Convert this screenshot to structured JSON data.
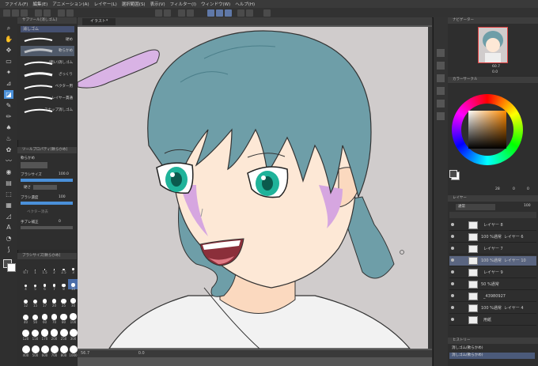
{
  "menu": [
    "ファイル(F)",
    "編集(E)",
    "アニメーション(A)",
    "レイヤー(L)",
    "選択範囲(S)",
    "表示(V)",
    "フィルター(I)",
    "ウィンドウ(W)",
    "ヘルプ(H)"
  ],
  "subtool": {
    "header": "サブツール[消しゴム]",
    "group_tab": "消しゴム",
    "items": [
      "硬め",
      "軟らかめ",
      "(粗い)消しゴム",
      "ざっくり",
      "ベクター用",
      "レイヤー貫通",
      "スナップ消しゴム"
    ],
    "selected_index": 1
  },
  "toolprop": {
    "header": "ツールプロパティ[軟らかめ]",
    "group": "軟らかめ",
    "rows": [
      {
        "label": "ブラシサイズ",
        "value": "100.0"
      },
      {
        "label": "硬さ",
        "value": ""
      },
      {
        "label": "ブラシ濃度",
        "value": "100"
      },
      {
        "label": "ベクター消去",
        "value": ""
      },
      {
        "label": "手ブレ補正",
        "value": "0"
      }
    ]
  },
  "brushsize": {
    "header": "ブラシサイズ[軟らかめ]",
    "values": [
      "0.7",
      "1",
      "1.5",
      "2",
      "2.5",
      "3",
      "4",
      "5",
      "6",
      "7",
      "8",
      "10",
      "12",
      "15",
      "17",
      "20",
      "25",
      "30",
      "40",
      "50",
      "60",
      "70",
      "80",
      "100",
      "120",
      "150",
      "170",
      "200",
      "250",
      "300",
      "400",
      "500",
      "600",
      "700",
      "800",
      "1000"
    ],
    "selected": "10"
  },
  "canvas": {
    "tab": "イラスト*"
  },
  "status": {
    "zoom": "56.7",
    "angle": "0.0"
  },
  "navigator": {
    "header": "ナビゲーター",
    "zoom": "60.7",
    "angle": "0.0"
  },
  "color": {
    "header": "カラーサークル",
    "h": "28",
    "s": "0",
    "v": "0",
    "main": "#4a4a4a",
    "sub": "#ffffff"
  },
  "layers": {
    "header": "レイヤー",
    "blend": "通常",
    "opacity": "100",
    "items": [
      {
        "opacity": "",
        "name": "レイヤー 8",
        "selected": false
      },
      {
        "opacity": "100 %通常",
        "name": "レイヤー 6",
        "selected": false
      },
      {
        "opacity": "",
        "name": "レイヤー 7",
        "selected": false
      },
      {
        "opacity": "100 %通常",
        "name": "レイヤー 10",
        "selected": true
      },
      {
        "opacity": "",
        "name": "レイヤー 9",
        "selected": false
      },
      {
        "opacity": "50 %通常",
        "name": "",
        "selected": false
      },
      {
        "opacity": "",
        "name": "_43980927",
        "selected": false
      },
      {
        "opacity": "100 %通常",
        "name": "レイヤー 4",
        "selected": false
      },
      {
        "opacity": "",
        "name": "用紙",
        "selected": false
      }
    ]
  },
  "history": {
    "header": "ヒストリー",
    "rows": [
      "消しゴム(軟らかめ)",
      "消しゴム(軟らかめ)"
    ]
  },
  "colors": {
    "hair": "#6e9ea8",
    "hair_dark": "#4b7f8a",
    "accent": "#4a90d9",
    "skin": "#fde3cf",
    "pink": "#d6a6e0",
    "eyes": "#1fb39a"
  }
}
